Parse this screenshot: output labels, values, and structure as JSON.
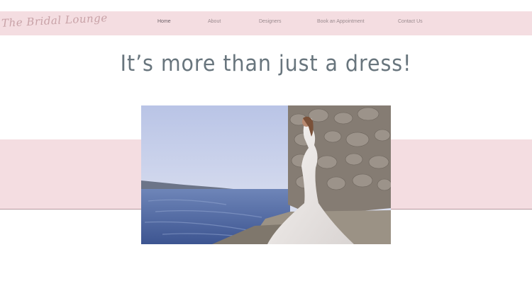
{
  "header": {
    "logo_text": "The Bridal Lounge",
    "nav": [
      {
        "label": "Home",
        "active": true
      },
      {
        "label": "About",
        "active": false
      },
      {
        "label": "Designers",
        "active": false
      },
      {
        "label": "Book an Appointment",
        "active": false
      },
      {
        "label": "Contact Us",
        "active": false
      }
    ]
  },
  "hero": {
    "title": "It’s more than just a dress!"
  },
  "colors": {
    "navbar_bg": "#f4dde1",
    "band_bg": "#f4dde1",
    "title_color": "#68757d",
    "logo_color": "#c8a2a7"
  }
}
